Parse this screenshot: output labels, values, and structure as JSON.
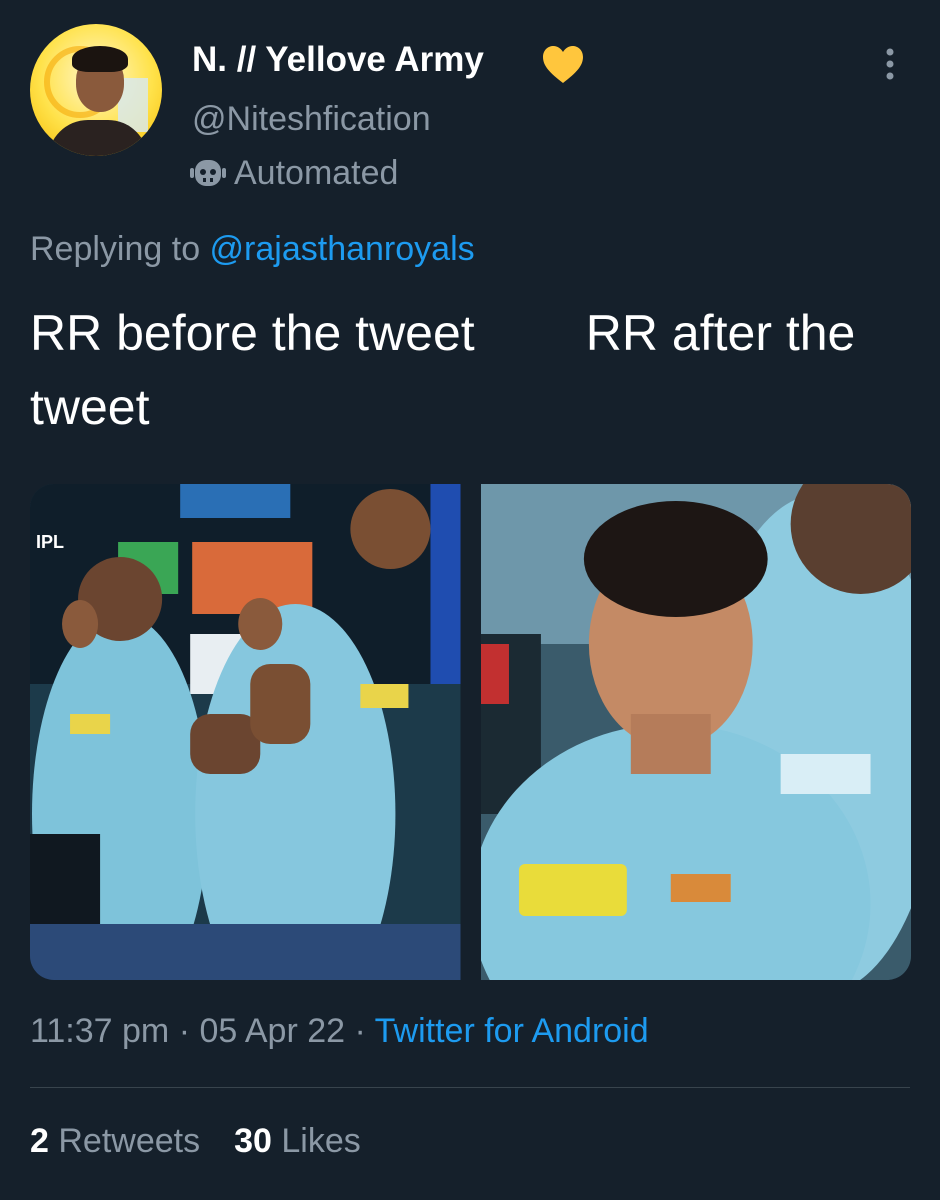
{
  "user": {
    "display_name": "N. // Yellove Army",
    "name_emoji": "yellow-heart",
    "handle": "@Niteshfication",
    "label": "Automated"
  },
  "reply": {
    "prefix": "Replying to ",
    "mention": "@rajasthanroyals"
  },
  "tweet": {
    "text": "RR before the tweet        RR after the tweet",
    "images": [
      {
        "description_icon": "celebration-photo"
      },
      {
        "description_icon": "serious-face-photo"
      }
    ]
  },
  "meta": {
    "time": "11:37 pm",
    "separator": " · ",
    "date": "05 Apr 22",
    "source": "Twitter for Android"
  },
  "stats": {
    "retweets_count": "2",
    "retweets_label": "Retweets",
    "likes_count": "30",
    "likes_label": "Likes"
  },
  "colors": {
    "background": "#15202b",
    "primary_text": "#ffffff",
    "secondary_text": "#8b98a5",
    "link": "#1d9bf0",
    "heart": "#ffc63d"
  }
}
